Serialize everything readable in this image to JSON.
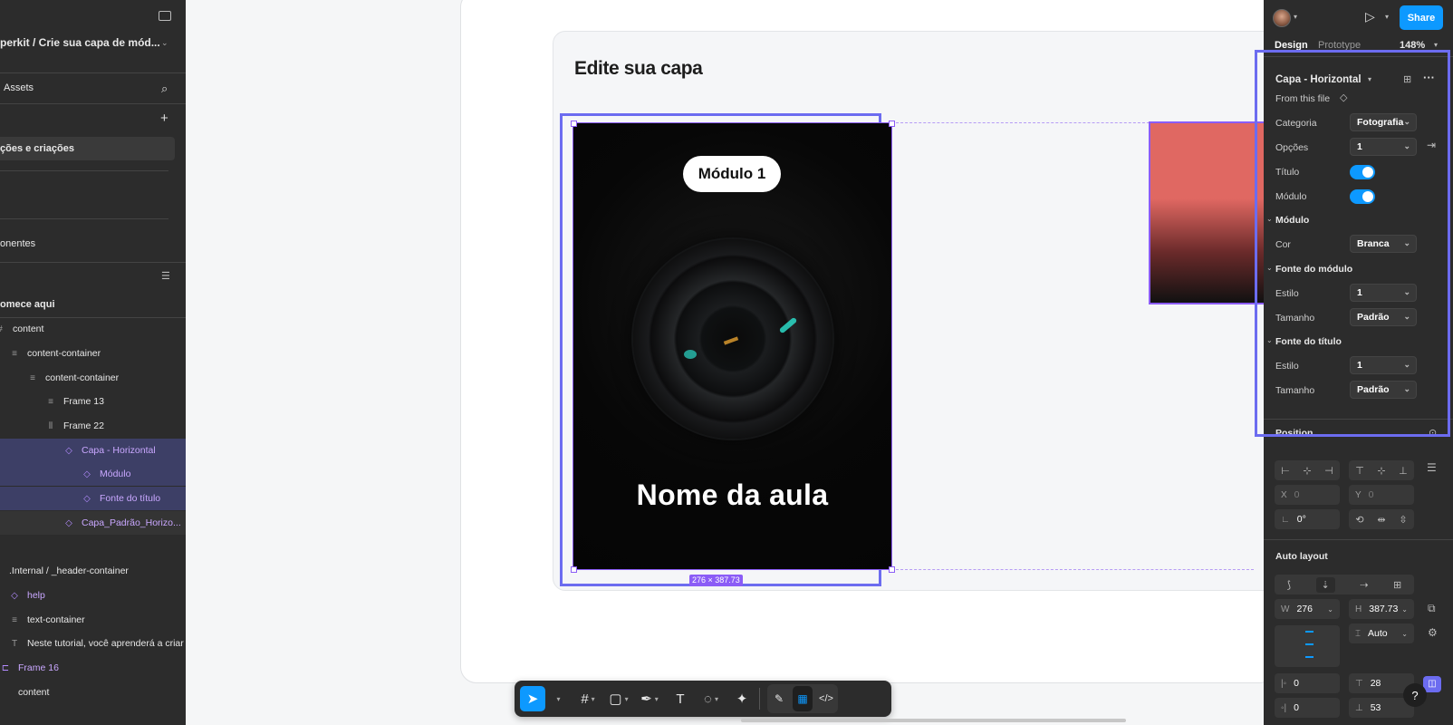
{
  "left": {
    "file_title": "perkit / Crie sua capa de mód...",
    "tab_assets": "Assets",
    "page_item": "ções e criações",
    "section_item": "onentes",
    "layer_root": "omece aqui",
    "layers": [
      {
        "label": "content",
        "icon": "frame-icon"
      },
      {
        "label": "content-container",
        "icon": "auto-layout-icon"
      },
      {
        "label": "content-container",
        "icon": "auto-layout-icon"
      },
      {
        "label": "Frame 13",
        "icon": "auto-layout-icon"
      },
      {
        "label": "Frame 22",
        "icon": "auto-layout-icon"
      },
      {
        "label": "Capa - Horizontal",
        "icon": "instance-icon"
      },
      {
        "label": "Módulo",
        "icon": "instance-icon"
      },
      {
        "label": "Fonte do título",
        "icon": "instance-icon"
      },
      {
        "label": "Capa_Padrão_Horizo...",
        "icon": "instance-icon"
      },
      {
        "label": ".Internal / _header-container",
        "icon": "frame-icon"
      },
      {
        "label": "help",
        "icon": "instance-icon"
      },
      {
        "label": "text-container",
        "icon": "auto-layout-icon"
      },
      {
        "label": "Neste tutorial, você aprenderá a criar u",
        "icon": "text-icon"
      },
      {
        "label": "Frame 16",
        "icon": "frame-icon"
      },
      {
        "label": "content",
        "icon": "frame-icon"
      }
    ]
  },
  "canvas": {
    "board_title": "Edite sua capa",
    "cover_module": "Módulo 1",
    "cover_title": "Nome da aula",
    "size_badge": "276 × 387.73"
  },
  "right": {
    "share_label": "Share",
    "tab_design": "Design",
    "tab_prototype": "Prototype",
    "zoom": "148%",
    "component_name": "Capa - Horizontal",
    "from_file": "From this file",
    "props": {
      "categoria": {
        "label": "Categoria",
        "value": "Fotografia"
      },
      "opcoes": {
        "label": "Opções",
        "value": "1"
      },
      "titulo": {
        "label": "Título",
        "on": true
      },
      "modulo": {
        "label": "Módulo",
        "on": true
      },
      "sec_modulo": "Módulo",
      "cor": {
        "label": "Cor",
        "value": "Branca"
      },
      "sec_fonte_modulo": "Fonte do módulo",
      "estilo1": {
        "label": "Estilo",
        "value": "1"
      },
      "tamanho1": {
        "label": "Tamanho",
        "value": "Padrão"
      },
      "sec_fonte_titulo": "Fonte do título",
      "estilo2": {
        "label": "Estilo",
        "value": "1"
      },
      "tamanho2": {
        "label": "Tamanho",
        "value": "Padrão"
      }
    },
    "position": {
      "title": "Position",
      "x_label": "X",
      "x_value": "0",
      "y_label": "Y",
      "y_value": "0",
      "rotation": "0°"
    },
    "auto_layout": {
      "title": "Auto layout",
      "w_label": "W",
      "w_value": "276",
      "h_label": "H",
      "h_value": "387.73",
      "gap_value": "Auto",
      "pad_left": "0",
      "pad_top": "28",
      "pad_bottom_left": "0",
      "pad_bottom": "53"
    },
    "help": "?"
  },
  "colors": {
    "accent": "#0d99ff",
    "selection": "#6c6cf0",
    "component": "#8b5cf6"
  }
}
